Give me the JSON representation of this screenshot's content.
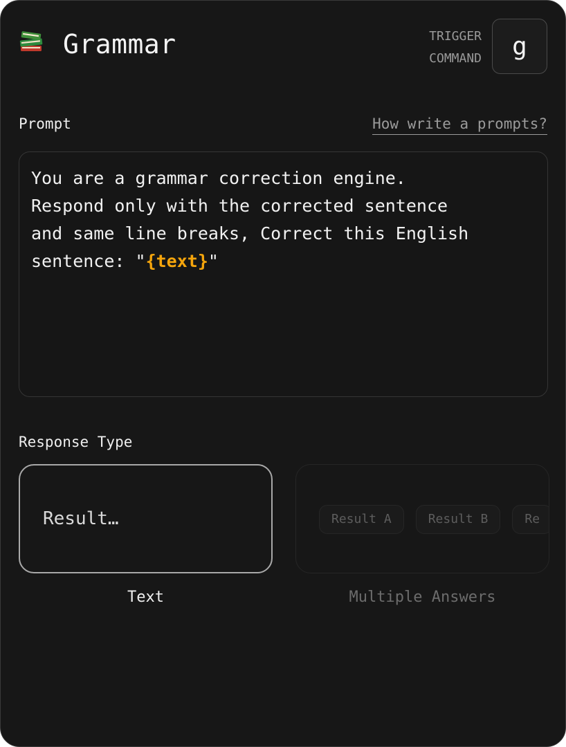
{
  "header": {
    "icon": "books-icon",
    "title": "Grammar",
    "trigger_label_line1": "TRIGGER",
    "trigger_label_line2": "COMMAND",
    "trigger_key": "g"
  },
  "prompt": {
    "label": "Prompt",
    "help_link": "How write a prompts?",
    "text_before": "You are a grammar correction engine.\nRespond only with the corrected sentence\nand same line breaks, Correct this English\nsentence: \"",
    "variable": "{text}",
    "text_after": "\""
  },
  "response_type": {
    "label": "Response Type",
    "options": [
      {
        "caption": "Text",
        "sample": "Result…",
        "selected": true
      },
      {
        "caption": "Multiple Answers",
        "chips": [
          "Result A",
          "Result B",
          "Re"
        ],
        "selected": false
      }
    ]
  },
  "colors": {
    "background": "#171717",
    "variable_accent": "#f5a50c",
    "selected_border": "#a9a9a9"
  }
}
